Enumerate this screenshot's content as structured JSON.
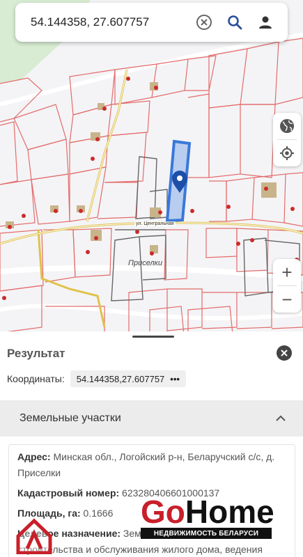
{
  "search": {
    "value": "54.144358, 27.607757"
  },
  "map": {
    "place_label": "Приселки",
    "street_label": "ул. Центральная"
  },
  "result": {
    "title": "Результат",
    "coords_label": "Координаты:",
    "coords_value": "54.144358,27.607757",
    "coords_more": "•••"
  },
  "section": {
    "title": "Земельные участки"
  },
  "parcel": {
    "address_label": "Адрес:",
    "address_value": " Минская обл., Логойский р-н, Беларучский с/с, д. Приселки",
    "cadastral_label": "Кадастровый номер:",
    "cadastral_value": " 623280406601000137",
    "area_label": "Площадь, га:",
    "area_value": " 0.1666",
    "purpose_label": "Целевое назначение:",
    "purpose_value": " Земельный участок для строительства и обслуживания жилого дома, ведения личного подсобного хозяйства"
  },
  "watermark": {
    "go": "Go",
    "home": "Home",
    "tagline": "НЕДВИЖИМОСТЬ БЕЛАРУСИ"
  },
  "colors": {
    "parcel_line": "#e46a6a",
    "selected_fill": "#b8cdf0",
    "selected_stroke": "#3a78d8",
    "pin": "#1d4fa8",
    "road": "#e0c24a"
  }
}
